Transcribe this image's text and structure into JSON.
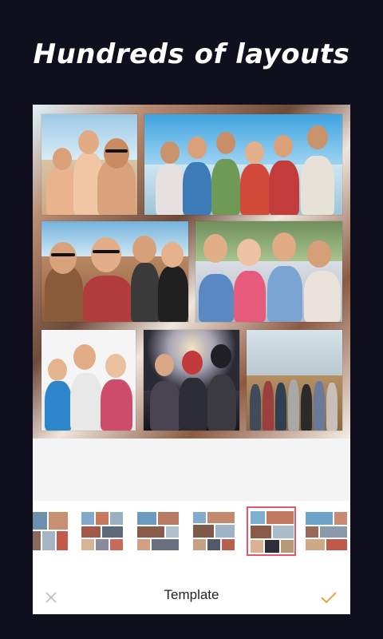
{
  "headline": "Hundreds of layouts",
  "editor": {
    "title": "Template",
    "close_icon": "close-icon",
    "confirm_icon": "check-icon"
  },
  "colors": {
    "background": "#0f0f1e",
    "accent_selected": "#e5566b",
    "confirm": "#f0a23a"
  },
  "templates": {
    "count_visible": 6,
    "selected_index": 4
  }
}
